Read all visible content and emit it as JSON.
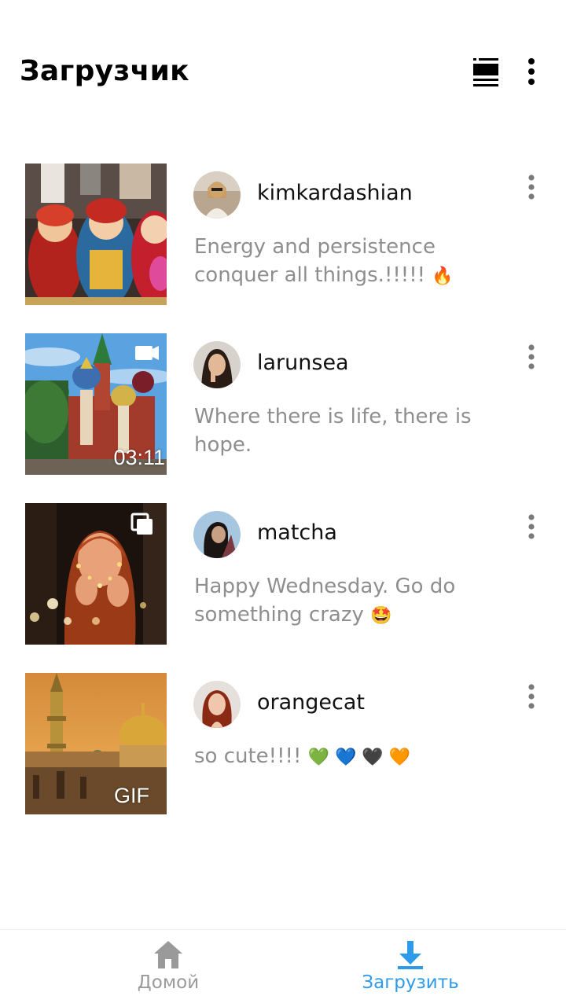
{
  "app": {
    "title": "Загрузчик"
  },
  "header": {
    "view_toggle_icon": "list-view-icon",
    "menu_icon": "more-vertical-icon"
  },
  "posts": [
    {
      "username": "kimkardashian",
      "caption": "Energy and persistence conquer all things.!!!!! ",
      "emoji": "🔥",
      "badge": "",
      "overlay": ""
    },
    {
      "username": "larunsea",
      "caption": "Where there is life, there is hope.",
      "emoji": "",
      "badge": "video-camera-icon",
      "overlay": "03:11"
    },
    {
      "username": "matcha",
      "caption": "Happy Wednesday. Go do something crazy ",
      "emoji": "🤩",
      "badge": "carousel-icon",
      "overlay": ""
    },
    {
      "username": "orangecat",
      "caption": "so cute!!!! ",
      "emoji": "💚 💙 🖤 🧡",
      "badge": "",
      "overlay": "GIF"
    }
  ],
  "nav": {
    "home_label": "Домой",
    "download_label": "Загрузить",
    "active": "download",
    "active_color": "#2e9bea",
    "inactive_color": "#9a9a9a"
  }
}
